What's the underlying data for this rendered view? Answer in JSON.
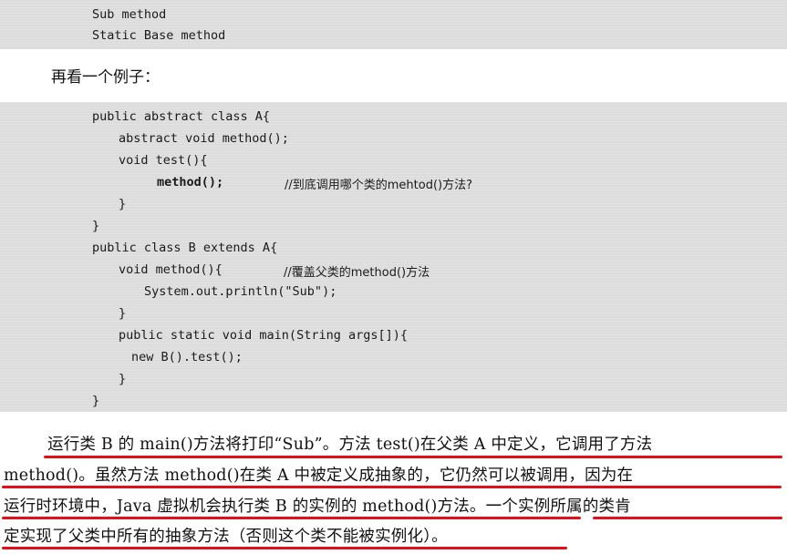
{
  "code_block_1": {
    "lines": [
      "Sub method",
      "Static Base method"
    ]
  },
  "intro_text": "再看一个例子：",
  "code_block_2": {
    "lines": [
      {
        "code": "public abstract class A{",
        "comment": ""
      },
      {
        "code": "abstract void method();",
        "comment": ""
      },
      {
        "code": "void test(){",
        "comment": ""
      },
      {
        "code": "method();",
        "comment": "//到底调用哪个类的mehtod()方法?"
      },
      {
        "code": "}",
        "comment": ""
      },
      {
        "code": "}",
        "comment": ""
      },
      {
        "code": "public class B extends A{",
        "comment": ""
      },
      {
        "code": "void method(){",
        "comment": "//覆盖父类的method()方法"
      },
      {
        "code": "System.out.println(\"Sub\");",
        "comment": ""
      },
      {
        "code": "}",
        "comment": ""
      },
      {
        "code": "public static void main(String args[]){",
        "comment": ""
      },
      {
        "code": "new B().test();",
        "comment": ""
      },
      {
        "code": "}",
        "comment": ""
      },
      {
        "code": "}",
        "comment": ""
      }
    ]
  },
  "paragraph": {
    "lines": [
      "运行类 B 的 main()方法将打印“Sub”。方法 test()在父类 A 中定义，它调用了方法",
      "method()。虽然方法 method()在类 A 中被定义成抽象的，它仍然可以被调用，因为在",
      "运行时环境中，Java 虚拟机会执行类 B 的实例的 method()方法。一个实例所属的类肯",
      "定实现了父类中所有的抽象方法（否则这个类不能被实例化）。"
    ]
  },
  "colors": {
    "code_background": "#dcdcdc",
    "underline": "#e0101a",
    "text": "#111111"
  }
}
